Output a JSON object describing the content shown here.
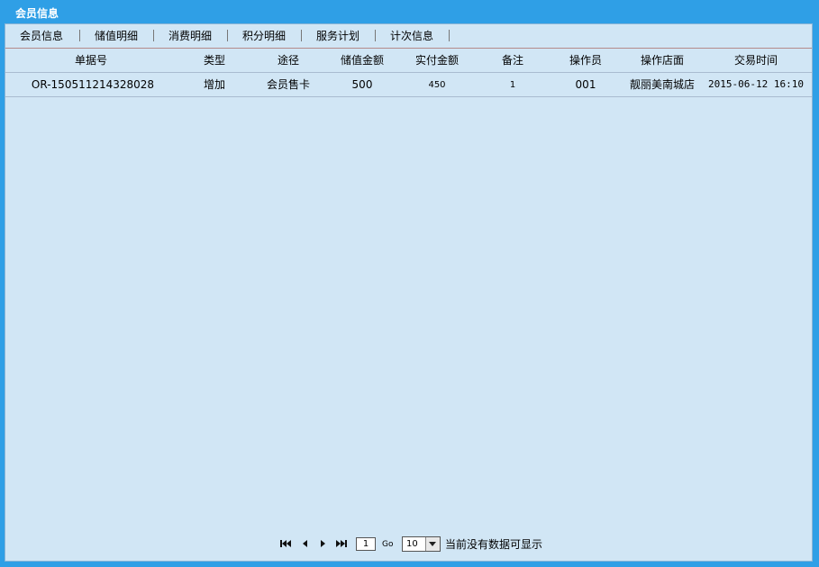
{
  "window": {
    "title": "会员信息"
  },
  "tabs": [
    {
      "label": "会员信息"
    },
    {
      "label": "储值明细"
    },
    {
      "label": "消费明细"
    },
    {
      "label": "积分明细"
    },
    {
      "label": "服务计划"
    },
    {
      "label": "计次信息"
    }
  ],
  "table": {
    "columns": [
      "单据号",
      "类型",
      "途径",
      "储值金额",
      "实付金额",
      "备注",
      "操作员",
      "操作店面",
      "交易时间"
    ],
    "rows": [
      {
        "order_no": "OR-150511214328028",
        "type": "增加",
        "channel": "会员售卡",
        "stored_amount": "500",
        "paid_amount": "450",
        "remark": "1",
        "operator": "001",
        "store": "靓丽美南城店",
        "time": "2015-06-12 16:10"
      }
    ]
  },
  "pager": {
    "current_page": "1",
    "go_label": "Go",
    "page_size": "10",
    "status_text": "当前没有数据可显示"
  },
  "colors": {
    "frame": "#2f9fe6",
    "panel": "#d1e6f5"
  }
}
